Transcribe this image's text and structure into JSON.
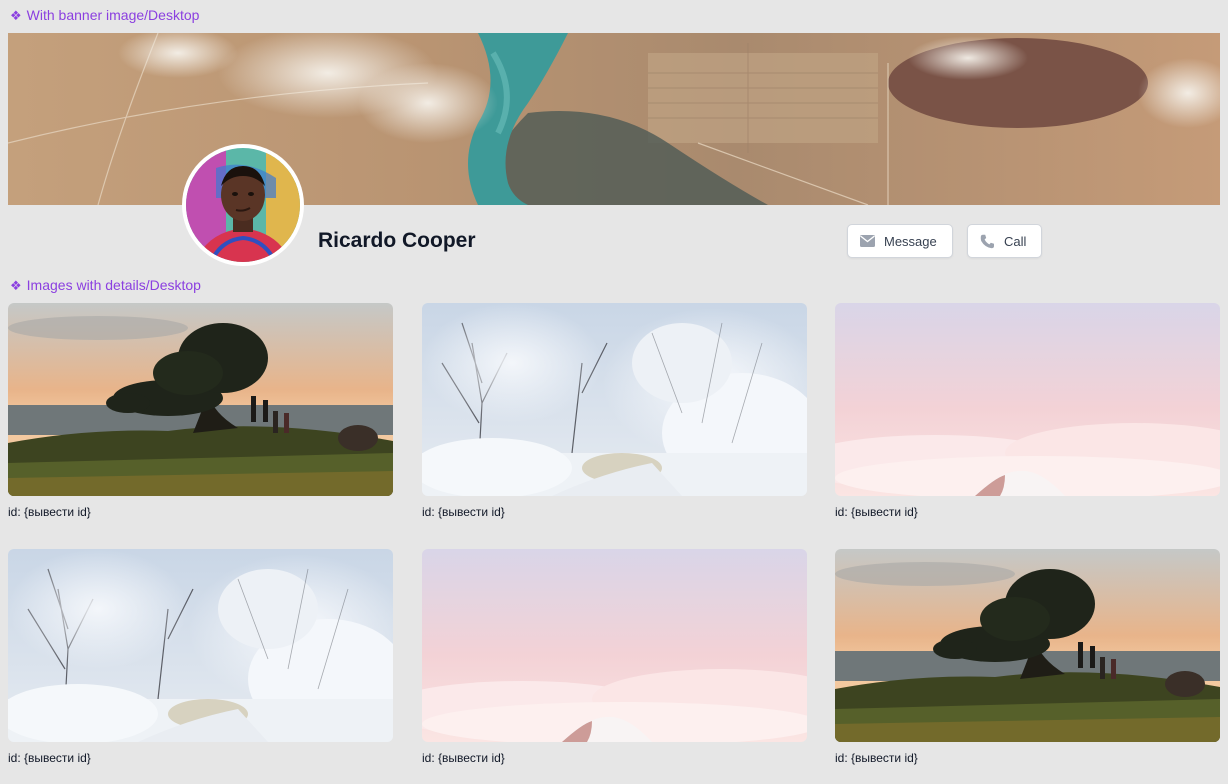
{
  "sections": {
    "banner_label": "With banner image/Desktop",
    "gallery_label": "Images with details/Desktop",
    "component_icon": "component-icon"
  },
  "profile": {
    "name": "Ricardo Cooper",
    "banner_image": "aerial-landscape",
    "avatar_image": "man-portrait"
  },
  "actions": {
    "message_label": "Message",
    "message_icon": "envelope-icon",
    "call_label": "Call",
    "call_icon": "phone-icon"
  },
  "gallery": [
    {
      "image": "tree-sunset",
      "caption": "id: {вывести id}"
    },
    {
      "image": "snowy-forest",
      "caption": "id: {вывести id}"
    },
    {
      "image": "pink-clouds-peak",
      "caption": "id: {вывести id}"
    },
    {
      "image": "snowy-forest",
      "caption": "id: {вывести id}"
    },
    {
      "image": "pink-clouds-peak",
      "caption": "id: {вывести id}"
    },
    {
      "image": "tree-sunset",
      "caption": "id: {вывести id}"
    }
  ],
  "colors": {
    "background": "#e6e6e6",
    "label_purple": "#8b3fe0",
    "name_text": "#111827"
  }
}
